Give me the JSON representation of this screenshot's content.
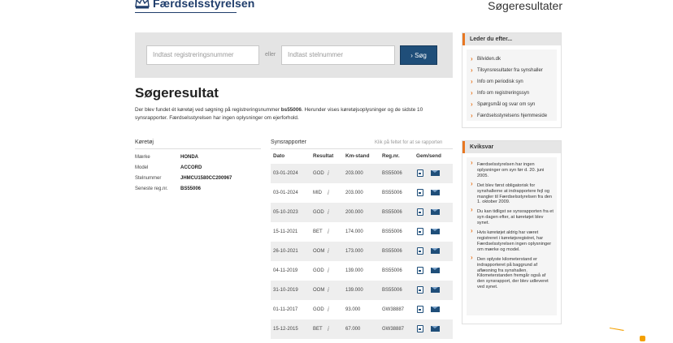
{
  "header": {
    "logo_text": "Færdselsstyrelsen",
    "page_heading": "Søgeresultater"
  },
  "search": {
    "reg_placeholder": "Indtast registreringsnummer",
    "or_label": "eller",
    "stel_placeholder": "Indtast stelnummer",
    "button_label": "› Søg"
  },
  "result": {
    "title": "Søgeresultat",
    "desc_prefix": "Der blev fundet ét køretøj ved søgning på registreringsnummer ",
    "desc_reg": "bs55006",
    "desc_suffix": ". Herunder vises køretøjsoplysninger og de sidste 10 synsrapporter. Færdselsstyrelsen har ingen oplysninger om ejerforhold."
  },
  "vehicle": {
    "heading": "Køretøj",
    "rows": [
      {
        "label": "Mærke",
        "value": "HONDA"
      },
      {
        "label": "Model",
        "value": "ACCORD"
      },
      {
        "label": "Stelnummer",
        "value": "JHMCU1580CC200967"
      },
      {
        "label": "Seneste reg.nr.",
        "value": "BS55006"
      }
    ]
  },
  "reports": {
    "heading": "Synsrapporter",
    "hint": "Klik på feltet for at se rapporten",
    "columns": [
      "Dato",
      "Resultat",
      "Km-stand",
      "Reg.nr.",
      "Gem/send"
    ],
    "rows": [
      {
        "date": "03-01-2024",
        "result": "GOD",
        "km": "203.000",
        "reg": "BS55006"
      },
      {
        "date": "03-01-2024",
        "result": "MID",
        "km": "203.000",
        "reg": "BS55006"
      },
      {
        "date": "05-10-2023",
        "result": "GOD",
        "km": "200.000",
        "reg": "BS55006"
      },
      {
        "date": "15-11-2021",
        "result": "BET",
        "km": "174.000",
        "reg": "BS55006"
      },
      {
        "date": "26-10-2021",
        "result": "OOM",
        "km": "173.000",
        "reg": "BS55006"
      },
      {
        "date": "04-11-2019",
        "result": "GOD",
        "km": "139.000",
        "reg": "BS55006"
      },
      {
        "date": "31-10-2019",
        "result": "OOM",
        "km": "139.000",
        "reg": "BS55006"
      },
      {
        "date": "01-11-2017",
        "result": "GOD",
        "km": "93.000",
        "reg": "GW38887"
      },
      {
        "date": "15-12-2015",
        "result": "BET",
        "km": "67.000",
        "reg": "GW38887"
      }
    ]
  },
  "sidebar": {
    "looking_for": {
      "heading": "Leder du efter...",
      "links": [
        "Bilviden.dk",
        "Tilsynsresultater fra synshaller",
        "Info om periodisk syn",
        "Info om registreringssyn",
        "Spørgsmål og svar om syn",
        "Færdselsstyrelsens hjemmeside"
      ]
    },
    "quick_answers": {
      "heading": "Kviksvar",
      "items": [
        "Færdselsstyrelsen har ingen oplysninger om syn før d. 20. juni 2005.",
        "Det blev først obligatorisk for synshallerne at indrapportere fejl og mangler til Færdselsstyrelsen fra den 1. oktober 2009.",
        "Du kan tidligst se synsrapporten fra et syn dagen efter, at køretøjet blev synet.",
        "Hvis køretøjet aldrig har været registreret i køretøjsregistret, har Færdselsstyrelsen ingen oplysninger om mærke og model.",
        "Den oplyste kilometerstand er indrapporteret på baggrund af aflæsning fra synshallen. Kilometerstanden fremgår også af den synsrapport, der blev udleveret ved synet."
      ]
    }
  },
  "colors": {
    "brand_blue": "#1f4e79",
    "accent_orange": "#e87722"
  }
}
